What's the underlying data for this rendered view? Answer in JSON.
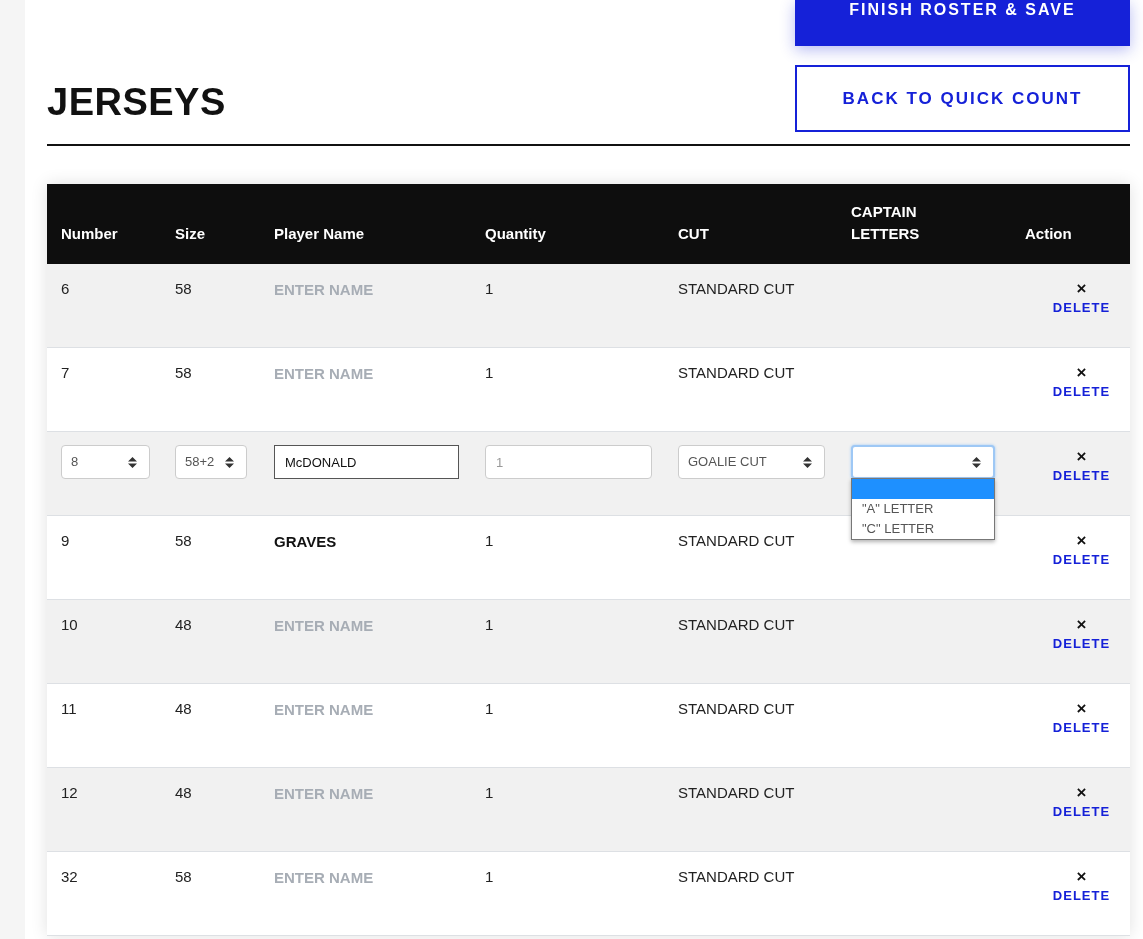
{
  "buttons": {
    "finish": "FINISH ROSTER & SAVE",
    "back": "BACK TO QUICK COUNT"
  },
  "title": "JERSEYS",
  "table": {
    "columns": [
      "Number",
      "Size",
      "Player Name",
      "Quantity",
      "CUT",
      "CAPTAIN LETTERS",
      "Action"
    ],
    "rows": [
      {
        "kind": "display",
        "number": "6",
        "size": "58",
        "player_name": "ENTER NAME",
        "name_set": false,
        "quantity": "1",
        "cut": "STANDARD CUT",
        "delete_icon": "×",
        "delete": "DELETE"
      },
      {
        "kind": "display",
        "number": "7",
        "size": "58",
        "player_name": "ENTER NAME",
        "name_set": false,
        "quantity": "1",
        "cut": "STANDARD CUT",
        "delete_icon": "×",
        "delete": "DELETE"
      },
      {
        "kind": "edit",
        "number": "8",
        "size": "58+2",
        "player_name": "McDONALD",
        "quantity": "1",
        "cut": "GOALIE CUT",
        "captain_dropdown": {
          "expanded": true,
          "options": [
            {
              "selected": true
            },
            {
              "label": "\"A\" LETTER",
              "selected": false
            },
            {
              "label": "\"C\" LETTER",
              "selected": false
            }
          ]
        },
        "delete_icon": "×",
        "delete": "DELETE"
      },
      {
        "kind": "display",
        "number": "9",
        "size": "58",
        "player_name": "GRAVES",
        "name_set": true,
        "quantity": "1",
        "cut": "STANDARD CUT",
        "delete_icon": "×",
        "delete": "DELETE"
      },
      {
        "kind": "display",
        "number": "10",
        "size": "48",
        "player_name": "ENTER NAME",
        "name_set": false,
        "quantity": "1",
        "cut": "STANDARD CUT",
        "delete_icon": "×",
        "delete": "DELETE"
      },
      {
        "kind": "display",
        "number": "11",
        "size": "48",
        "player_name": "ENTER NAME",
        "name_set": false,
        "quantity": "1",
        "cut": "STANDARD CUT",
        "delete_icon": "×",
        "delete": "DELETE"
      },
      {
        "kind": "display",
        "number": "12",
        "size": "48",
        "player_name": "ENTER NAME",
        "name_set": false,
        "quantity": "1",
        "cut": "STANDARD CUT",
        "delete_icon": "×",
        "delete": "DELETE"
      },
      {
        "kind": "display",
        "number": "32",
        "size": "58",
        "player_name": "ENTER NAME",
        "name_set": false,
        "quantity": "1",
        "cut": "STANDARD CUT",
        "delete_icon": "×",
        "delete": "DELETE"
      }
    ]
  }
}
